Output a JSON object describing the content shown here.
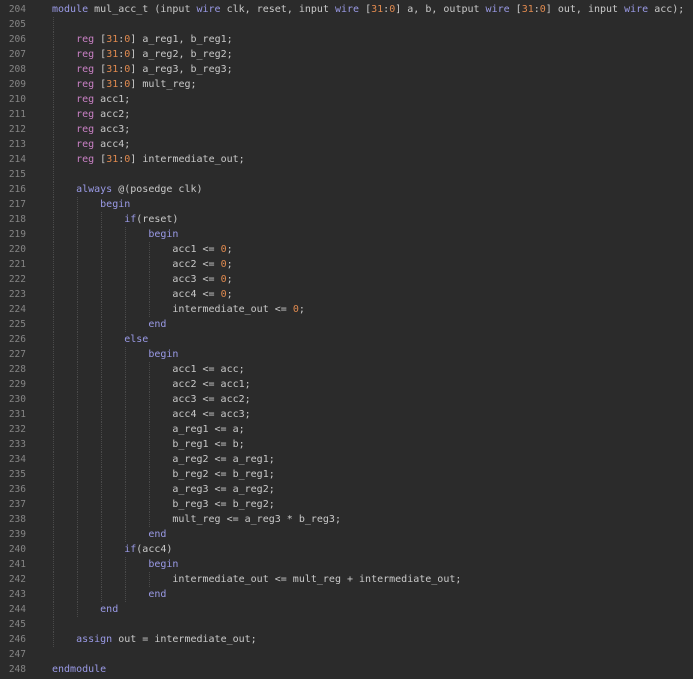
{
  "editor": {
    "colors": {
      "background": "#2b2b2b",
      "keyword": "#9a9ae6",
      "type": "#c980c4",
      "number": "#e08a4f",
      "text": "#c9c9c9",
      "line_number": "#858585"
    },
    "lines": [
      {
        "num": "204",
        "indent": 0,
        "tokens": [
          [
            "kw",
            "module"
          ],
          [
            "txt",
            " mul_acc_t (input "
          ],
          [
            "kw",
            "wire"
          ],
          [
            "txt",
            " clk, reset, input "
          ],
          [
            "kw",
            "wire"
          ],
          [
            "txt",
            " ["
          ],
          [
            "num",
            "31"
          ],
          [
            "txt",
            ":"
          ],
          [
            "num",
            "0"
          ],
          [
            "txt",
            "] a, b, output "
          ],
          [
            "kw",
            "wire"
          ],
          [
            "txt",
            " ["
          ],
          [
            "num",
            "31"
          ],
          [
            "txt",
            ":"
          ],
          [
            "num",
            "0"
          ],
          [
            "txt",
            "] out, input "
          ],
          [
            "kw",
            "wire"
          ],
          [
            "txt",
            " acc);"
          ]
        ]
      },
      {
        "num": "205",
        "indent": 0,
        "guides": 1,
        "tokens": []
      },
      {
        "num": "206",
        "indent": 1,
        "tokens": [
          [
            "type",
            "reg"
          ],
          [
            "txt",
            " ["
          ],
          [
            "num",
            "31"
          ],
          [
            "txt",
            ":"
          ],
          [
            "num",
            "0"
          ],
          [
            "txt",
            "] a_reg1, b_reg1;"
          ]
        ]
      },
      {
        "num": "207",
        "indent": 1,
        "tokens": [
          [
            "type",
            "reg"
          ],
          [
            "txt",
            " ["
          ],
          [
            "num",
            "31"
          ],
          [
            "txt",
            ":"
          ],
          [
            "num",
            "0"
          ],
          [
            "txt",
            "] a_reg2, b_reg2;"
          ]
        ]
      },
      {
        "num": "208",
        "indent": 1,
        "tokens": [
          [
            "type",
            "reg"
          ],
          [
            "txt",
            " ["
          ],
          [
            "num",
            "31"
          ],
          [
            "txt",
            ":"
          ],
          [
            "num",
            "0"
          ],
          [
            "txt",
            "] a_reg3, b_reg3;"
          ]
        ]
      },
      {
        "num": "209",
        "indent": 1,
        "tokens": [
          [
            "type",
            "reg"
          ],
          [
            "txt",
            " ["
          ],
          [
            "num",
            "31"
          ],
          [
            "txt",
            ":"
          ],
          [
            "num",
            "0"
          ],
          [
            "txt",
            "] mult_reg;"
          ]
        ]
      },
      {
        "num": "210",
        "indent": 1,
        "tokens": [
          [
            "type",
            "reg"
          ],
          [
            "txt",
            " acc1;"
          ]
        ]
      },
      {
        "num": "211",
        "indent": 1,
        "tokens": [
          [
            "type",
            "reg"
          ],
          [
            "txt",
            " acc2;"
          ]
        ]
      },
      {
        "num": "212",
        "indent": 1,
        "tokens": [
          [
            "type",
            "reg"
          ],
          [
            "txt",
            " acc3;"
          ]
        ]
      },
      {
        "num": "213",
        "indent": 1,
        "tokens": [
          [
            "type",
            "reg"
          ],
          [
            "txt",
            " acc4;"
          ]
        ]
      },
      {
        "num": "214",
        "indent": 1,
        "tokens": [
          [
            "type",
            "reg"
          ],
          [
            "txt",
            " ["
          ],
          [
            "num",
            "31"
          ],
          [
            "txt",
            ":"
          ],
          [
            "num",
            "0"
          ],
          [
            "txt",
            "] intermediate_out;"
          ]
        ]
      },
      {
        "num": "215",
        "indent": 0,
        "guides": 1,
        "tokens": []
      },
      {
        "num": "216",
        "indent": 1,
        "tokens": [
          [
            "kw",
            "always"
          ],
          [
            "txt",
            " @(posedge clk)"
          ]
        ]
      },
      {
        "num": "217",
        "indent": 2,
        "tokens": [
          [
            "kw",
            "begin"
          ]
        ]
      },
      {
        "num": "218",
        "indent": 3,
        "tokens": [
          [
            "kw",
            "if"
          ],
          [
            "txt",
            "(reset)"
          ]
        ]
      },
      {
        "num": "219",
        "indent": 4,
        "tokens": [
          [
            "kw",
            "begin"
          ]
        ]
      },
      {
        "num": "220",
        "indent": 5,
        "tokens": [
          [
            "txt",
            "acc1 <= "
          ],
          [
            "num",
            "0"
          ],
          [
            "txt",
            ";"
          ]
        ]
      },
      {
        "num": "221",
        "indent": 5,
        "tokens": [
          [
            "txt",
            "acc2 <= "
          ],
          [
            "num",
            "0"
          ],
          [
            "txt",
            ";"
          ]
        ]
      },
      {
        "num": "222",
        "indent": 5,
        "tokens": [
          [
            "txt",
            "acc3 <= "
          ],
          [
            "num",
            "0"
          ],
          [
            "txt",
            ";"
          ]
        ]
      },
      {
        "num": "223",
        "indent": 5,
        "tokens": [
          [
            "txt",
            "acc4 <= "
          ],
          [
            "num",
            "0"
          ],
          [
            "txt",
            ";"
          ]
        ]
      },
      {
        "num": "224",
        "indent": 5,
        "tokens": [
          [
            "txt",
            "intermediate_out <= "
          ],
          [
            "num",
            "0"
          ],
          [
            "txt",
            ";"
          ]
        ]
      },
      {
        "num": "225",
        "indent": 4,
        "tokens": [
          [
            "kw",
            "end"
          ]
        ]
      },
      {
        "num": "226",
        "indent": 3,
        "tokens": [
          [
            "kw",
            "else"
          ]
        ]
      },
      {
        "num": "227",
        "indent": 4,
        "tokens": [
          [
            "kw",
            "begin"
          ]
        ]
      },
      {
        "num": "228",
        "indent": 5,
        "tokens": [
          [
            "txt",
            "acc1 <= acc;"
          ]
        ]
      },
      {
        "num": "229",
        "indent": 5,
        "tokens": [
          [
            "txt",
            "acc2 <= acc1;"
          ]
        ]
      },
      {
        "num": "230",
        "indent": 5,
        "tokens": [
          [
            "txt",
            "acc3 <= acc2;"
          ]
        ]
      },
      {
        "num": "231",
        "indent": 5,
        "tokens": [
          [
            "txt",
            "acc4 <= acc3;"
          ]
        ]
      },
      {
        "num": "232",
        "indent": 5,
        "tokens": [
          [
            "txt",
            "a_reg1 <= a;"
          ]
        ]
      },
      {
        "num": "233",
        "indent": 5,
        "tokens": [
          [
            "txt",
            "b_reg1 <= b;"
          ]
        ]
      },
      {
        "num": "234",
        "indent": 5,
        "tokens": [
          [
            "txt",
            "a_reg2 <= a_reg1;"
          ]
        ]
      },
      {
        "num": "235",
        "indent": 5,
        "tokens": [
          [
            "txt",
            "b_reg2 <= b_reg1;"
          ]
        ]
      },
      {
        "num": "236",
        "indent": 5,
        "tokens": [
          [
            "txt",
            "a_reg3 <= a_reg2;"
          ]
        ]
      },
      {
        "num": "237",
        "indent": 5,
        "tokens": [
          [
            "txt",
            "b_reg3 <= b_reg2;"
          ]
        ]
      },
      {
        "num": "238",
        "indent": 5,
        "tokens": [
          [
            "txt",
            "mult_reg <= a_reg3 * b_reg3;"
          ]
        ]
      },
      {
        "num": "239",
        "indent": 4,
        "tokens": [
          [
            "kw",
            "end"
          ]
        ]
      },
      {
        "num": "240",
        "indent": 3,
        "tokens": [
          [
            "kw",
            "if"
          ],
          [
            "txt",
            "(acc4)"
          ]
        ]
      },
      {
        "num": "241",
        "indent": 4,
        "tokens": [
          [
            "kw",
            "begin"
          ]
        ]
      },
      {
        "num": "242",
        "indent": 5,
        "tokens": [
          [
            "txt",
            "intermediate_out <= mult_reg + intermediate_out;"
          ]
        ]
      },
      {
        "num": "243",
        "indent": 4,
        "tokens": [
          [
            "kw",
            "end"
          ]
        ]
      },
      {
        "num": "244",
        "indent": 2,
        "tokens": [
          [
            "kw",
            "end"
          ]
        ]
      },
      {
        "num": "245",
        "indent": 0,
        "guides": 1,
        "tokens": []
      },
      {
        "num": "246",
        "indent": 1,
        "tokens": [
          [
            "kw",
            "assign"
          ],
          [
            "txt",
            " out = intermediate_out;"
          ]
        ]
      },
      {
        "num": "247",
        "indent": 0,
        "tokens": []
      },
      {
        "num": "248",
        "indent": 0,
        "tokens": [
          [
            "kw",
            "endmodule"
          ]
        ]
      }
    ]
  }
}
